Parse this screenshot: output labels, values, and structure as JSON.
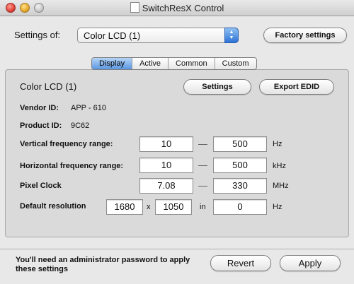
{
  "window": {
    "title": "SwitchResX Control"
  },
  "header": {
    "settings_of_label": "Settings of:",
    "display_select_value": "Color LCD (1)",
    "factory_button": "Factory settings"
  },
  "tabs": [
    {
      "label": "Display",
      "selected": true
    },
    {
      "label": "Active",
      "selected": false
    },
    {
      "label": "Common",
      "selected": false
    },
    {
      "label": "Custom",
      "selected": false
    }
  ],
  "panel": {
    "display_name": "Color LCD (1)",
    "settings_button": "Settings",
    "export_button": "Export EDID",
    "vendor_label": "Vendor ID:",
    "vendor_value": "APP - 610",
    "product_label": "Product ID:",
    "product_value": "9C62",
    "vertical": {
      "label": "Vertical frequency range:",
      "min": "10",
      "max": "500",
      "unit": "Hz"
    },
    "horizontal": {
      "label": "Horizontal frequency range:",
      "min": "10",
      "max": "500",
      "unit": "kHz"
    },
    "pixel_clock": {
      "label": "Pixel Clock",
      "min": "7.08",
      "max": "330",
      "unit": "MHz"
    },
    "default_resolution": {
      "label": "Default resolution",
      "width": "1680",
      "times": "x",
      "height": "1050",
      "in": "in",
      "rate": "0",
      "unit": "Hz"
    },
    "dash": "—"
  },
  "footer": {
    "note": "You'll need an administrator password to apply these settings",
    "revert_button": "Revert",
    "apply_button": "Apply"
  },
  "colors": {
    "accent": "#3b82db",
    "window_bg": "#e8e8e8"
  }
}
